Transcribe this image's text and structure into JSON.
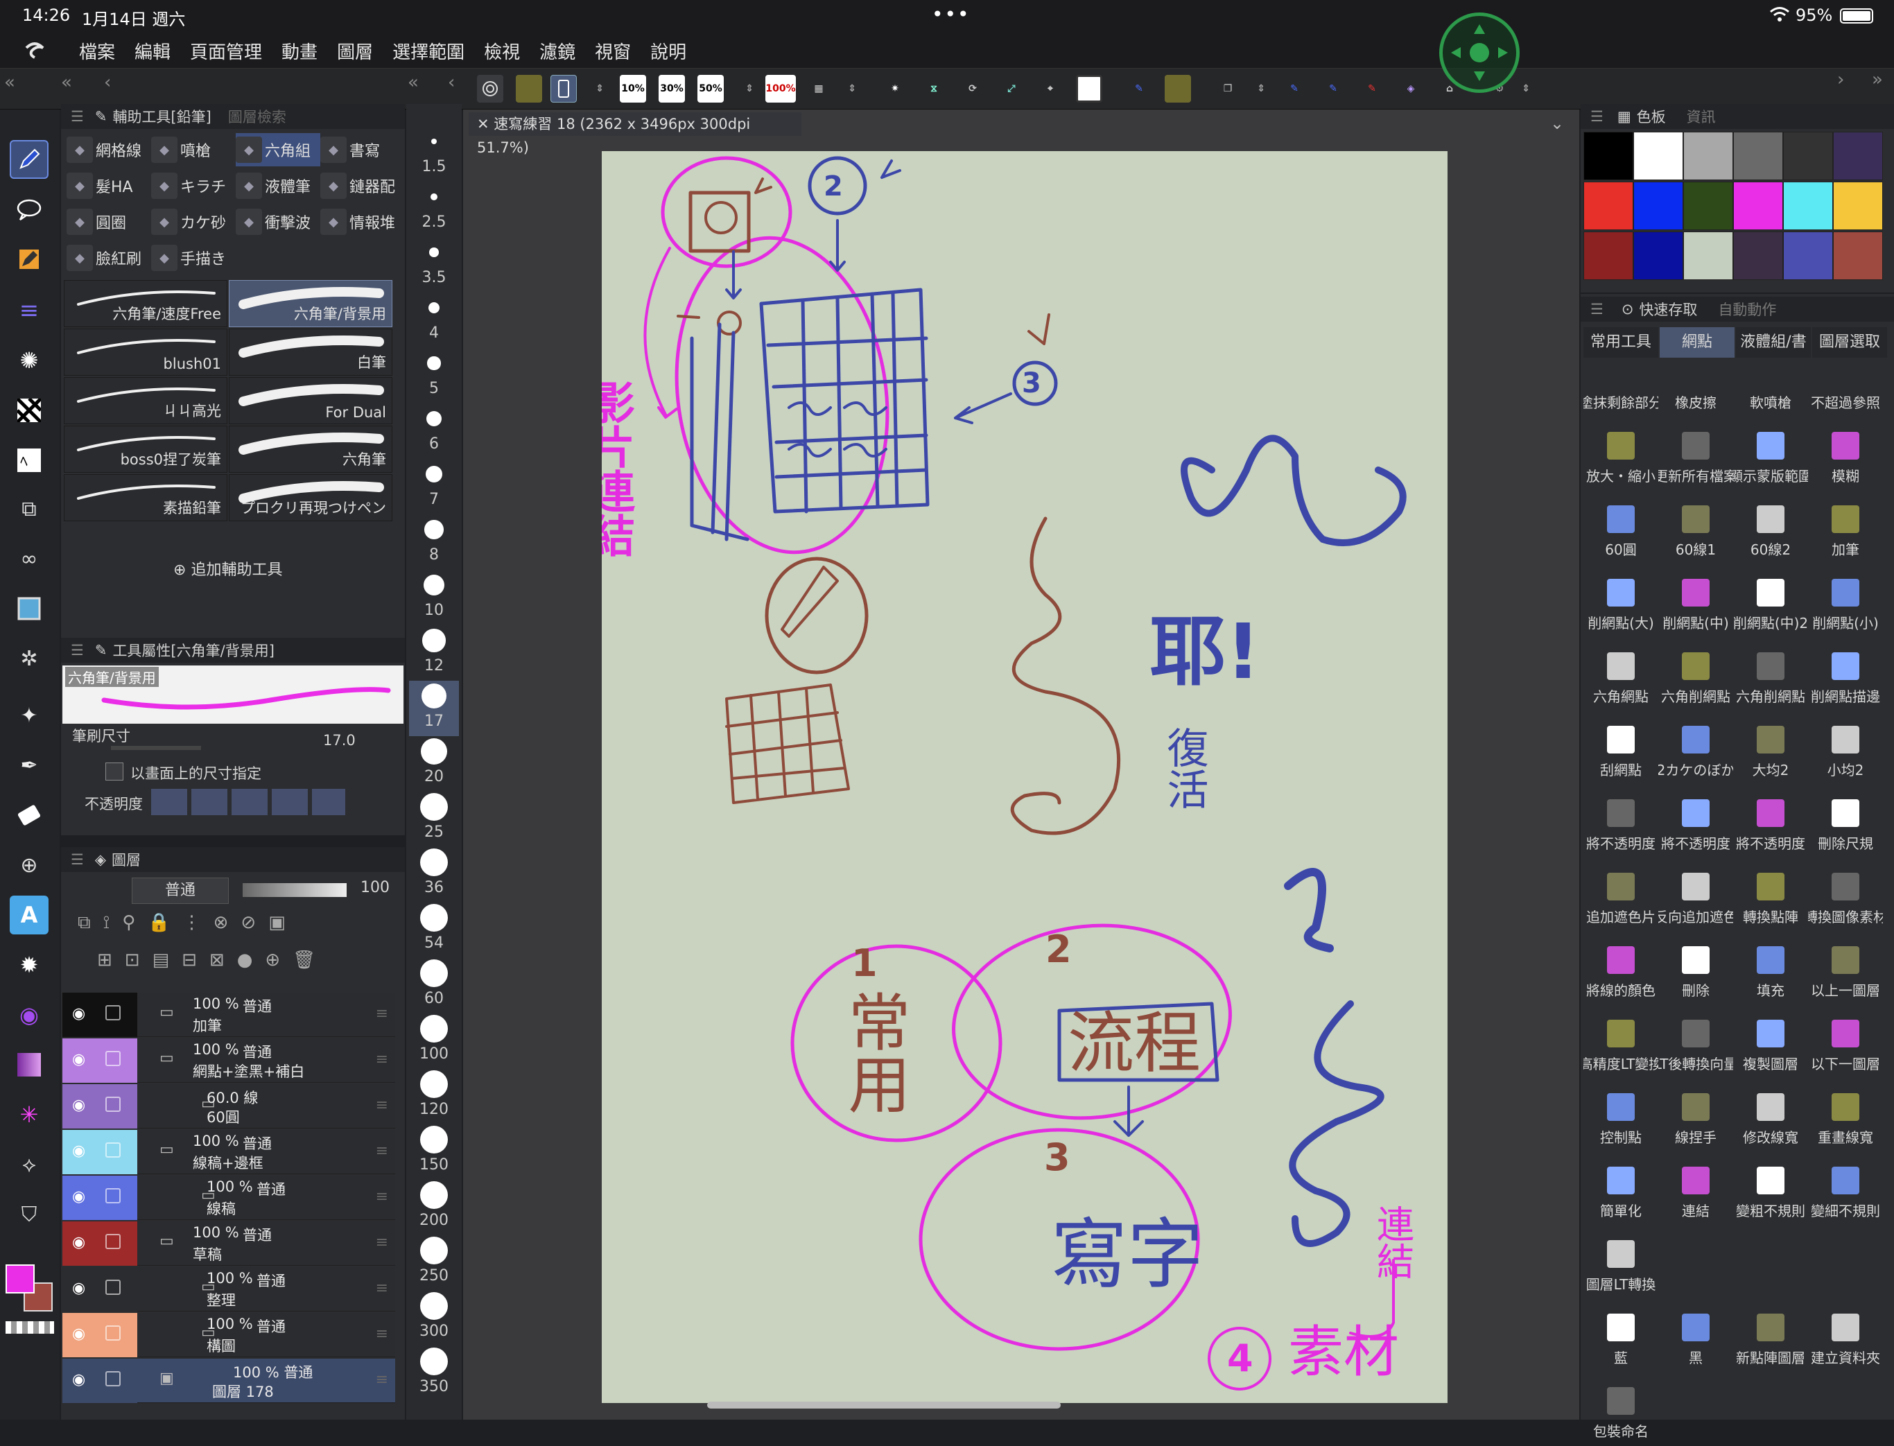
{
  "status": {
    "time": "14:26",
    "date": "1月14日 週六",
    "battery": "95%",
    "dots": "•••"
  },
  "menu": [
    "檔案",
    "編輯",
    "頁面管理",
    "動畫",
    "圖層",
    "選擇範圍",
    "檢視",
    "濾鏡",
    "視窗",
    "說明"
  ],
  "toolbar": {
    "pct10": "10%",
    "pct30": "30%",
    "pct50": "50%",
    "pct100": "100%"
  },
  "subtool_panel": {
    "title": "輔助工具[鉛筆]",
    "title2": "圖層檢索",
    "items": [
      "網格線",
      "噴槍",
      "六角組",
      "書寫",
      "髮HA",
      "キラチ",
      "液體筆",
      "鏈器配",
      "圓圈",
      "カケ砂",
      "衝擊波",
      "情報堆",
      "臉紅刷",
      "手描き"
    ],
    "brushes": [
      "六角筆/速度Free",
      "六角筆/背景用",
      "blush01",
      "白筆",
      "ㄐㄐ高光",
      "For Dual",
      "boss0捏了炭筆",
      "六角筆",
      "素描鉛筆",
      "プロクリ再現つけペン"
    ],
    "add": "追加輔助工具"
  },
  "tool_property": {
    "title": "工具屬性[六角筆/背景用]",
    "preview_label": "六角筆/背景用",
    "brush_size_label": "筆刷尺寸",
    "brush_size": "17.0",
    "screen_size": "以畫面上的尺寸指定",
    "opacity_label": "不透明度"
  },
  "brush_sizes": [
    "1.5",
    "2.5",
    "3.5",
    "4",
    "5",
    "6",
    "7",
    "8",
    "10",
    "12",
    "17",
    "20",
    "25",
    "36",
    "54",
    "60",
    "100",
    "120",
    "150",
    "200",
    "250",
    "300",
    "350"
  ],
  "layers_panel": {
    "title": "圖層",
    "blend": "普通",
    "opacity": "100",
    "layers": [
      {
        "pct": "100 %",
        "mode": "普通",
        "name": "加筆",
        "color": "#111"
      },
      {
        "pct": "100 %",
        "mode": "普通",
        "name": "網點+塗黑+補白",
        "color": "#b57de0"
      },
      {
        "pct": "60.0 線",
        "mode": "",
        "name": "60圓",
        "color": "#8e6bc2"
      },
      {
        "pct": "100 %",
        "mode": "普通",
        "name": "線稿+邊框",
        "color": "#8fd9f0"
      },
      {
        "pct": "100 %",
        "mode": "普通",
        "name": "線稿",
        "color": "#5e6fe0"
      },
      {
        "pct": "100 %",
        "mode": "普通",
        "name": "草稿",
        "color": "#9e2a2a"
      },
      {
        "pct": "100 %",
        "mode": "普通",
        "name": "整理",
        "color": "#2b2c2f"
      },
      {
        "pct": "100 %",
        "mode": "普通",
        "name": "構圖",
        "color": "#f0a37e"
      },
      {
        "pct": "100 % 普通",
        "mode": "",
        "name": "圖層 178",
        "color": "#3c4a6a"
      }
    ]
  },
  "canvas": {
    "tab": "速寫練習 18 (2362 x 3496px 300dpi 51.7%)",
    "bg": "#c9d3c0"
  },
  "color_panel": {
    "title": "色板",
    "title2": "資訊",
    "swatches": [
      "#000000",
      "#ffffff",
      "#a8a8a8",
      "#6a6a6a",
      "#333333",
      "#3b2f5a",
      "#e8302a",
      "#0a2bf0",
      "#2d4a18",
      "#ea2ee8",
      "#5ce9f4",
      "#f5c63a",
      "#8c2222",
      "#0a10a0",
      "#c5cfbf",
      "#3c2f45",
      "#4b4fb0",
      "#9e4a40"
    ]
  },
  "quick_access": {
    "title": "快速存取",
    "title2": "自動動作",
    "tabs": [
      "常用工具",
      "網點",
      "液體組/書",
      "圖層選取"
    ],
    "items": [
      "塗抹剩餘部分",
      "橡皮擦",
      "軟噴槍",
      "不超過參照",
      "放大・縮小",
      "更新所有檔案",
      "顯示蒙版範圍",
      "模糊",
      "60圓",
      "60線1",
      "60線2",
      "加筆",
      "削網點(大)",
      "削網點(中)",
      "削網點(中)2",
      "削網點(小)",
      "六角網點",
      "六角削網點",
      "六角削網點",
      "削網點描邊",
      "刮網點",
      "2カケのぼか",
      "大均2",
      "小均2",
      "將不透明度",
      "將不透明度",
      "將不透明度",
      "刪除尺規",
      "追加遮色片",
      "反向追加遮色",
      "轉換點陣",
      "轉換圖像素材",
      "將線的顏色",
      "刪除",
      "填充",
      "以上一圖層",
      "高精度LT變換",
      "LT後轉換向量",
      "複製圖層",
      "以下一圖層",
      "控制點",
      "線捏手",
      "修改線寬",
      "重畫線寬",
      "簡單化",
      "連結",
      "變粗不規則",
      "變細不規則",
      "圖層LT轉換",
      "",
      "",
      "",
      "藍",
      "黑",
      "新點陣圖層",
      "建立資料夾",
      "包裝命名"
    ]
  },
  "drawing_text": [
    "影片連結",
    "耶!",
    "復活",
    "1",
    "2",
    "3",
    "4",
    "常用",
    "流程",
    "寫字",
    "素材",
    "連結"
  ]
}
